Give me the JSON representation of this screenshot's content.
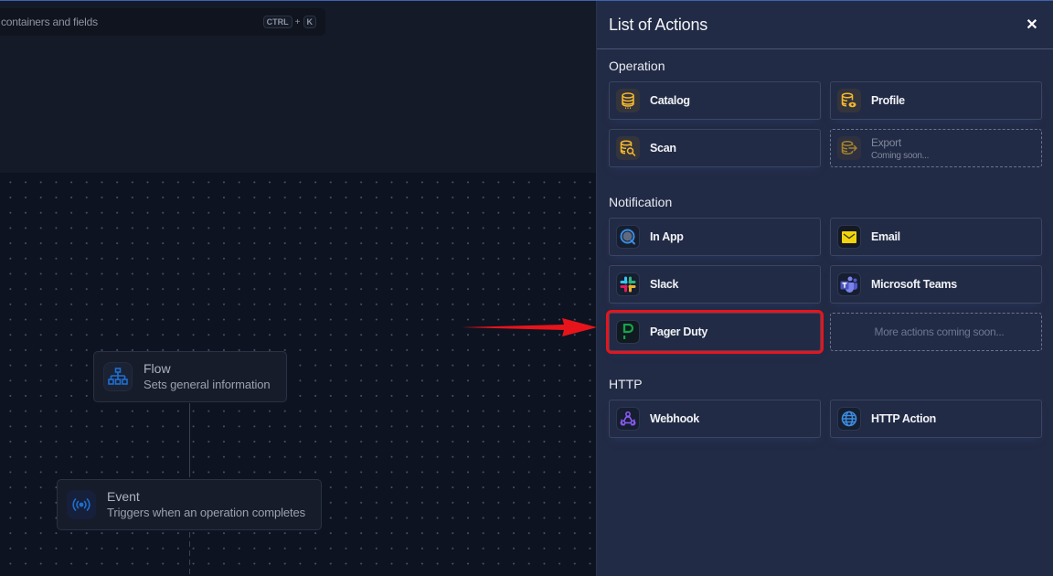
{
  "search": {
    "text": "containers and fields",
    "shortcut_key1": "CTRL",
    "shortcut_plus": "+",
    "shortcut_key2": "K"
  },
  "flow_nodes": [
    {
      "title": "Flow",
      "subtitle": "Sets general information",
      "icon": "sitemap-icon"
    },
    {
      "title": "Event",
      "subtitle": "Triggers when an operation completes",
      "icon": "broadcast-icon"
    }
  ],
  "panel": {
    "title": "List of Actions",
    "close_icon": "close-icon",
    "sections": [
      {
        "title": "Operation",
        "items": [
          {
            "label": "Catalog",
            "icon": "database-icon",
            "enabled": true
          },
          {
            "label": "Profile",
            "icon": "database-eye-icon",
            "enabled": true
          },
          {
            "label": "Scan",
            "icon": "database-search-icon",
            "enabled": true
          },
          {
            "label": "Export",
            "sublabel": "Coming soon...",
            "icon": "database-export-icon",
            "enabled": false
          }
        ]
      },
      {
        "title": "Notification",
        "items": [
          {
            "label": "In App",
            "icon": "in-app-icon",
            "enabled": true
          },
          {
            "label": "Email",
            "icon": "email-icon",
            "enabled": true
          },
          {
            "label": "Slack",
            "icon": "slack-icon",
            "enabled": true
          },
          {
            "label": "Microsoft Teams",
            "icon": "teams-icon",
            "enabled": true
          },
          {
            "label": "Pager Duty",
            "icon": "pagerduty-icon",
            "enabled": true,
            "highlighted": true
          },
          {
            "label": "More actions coming soon...",
            "enabled": false
          }
        ]
      },
      {
        "title": "HTTP",
        "items": [
          {
            "label": "Webhook",
            "icon": "webhook-icon",
            "enabled": true
          },
          {
            "label": "HTTP Action",
            "icon": "globe-icon",
            "enabled": true
          }
        ]
      }
    ]
  },
  "annotation": {
    "type": "arrow",
    "color": "#e8141b",
    "points_to": "Pager Duty"
  },
  "colors": {
    "panel_bg": "#222b45",
    "canvas_bg": "#0e1321",
    "highlight": "#e8141b",
    "amber_icon": "#f5b82e",
    "pagerduty_green": "#16a34a",
    "accent_blue": "#1f6fd1"
  }
}
